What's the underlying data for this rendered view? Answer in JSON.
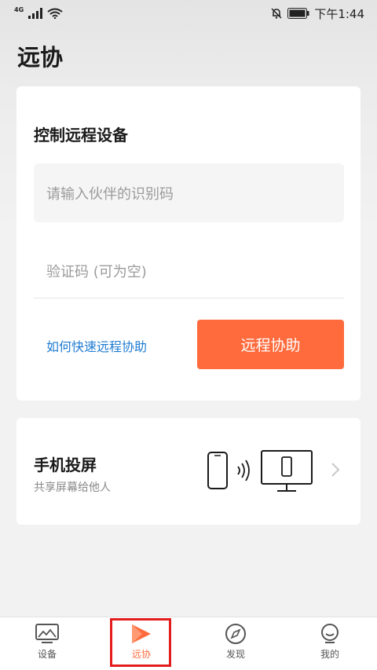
{
  "status_bar": {
    "network": "4G",
    "time": "下午1:44"
  },
  "page": {
    "title": "远协"
  },
  "remote_card": {
    "title": "控制远程设备",
    "partner_placeholder": "请输入伙伴的识别码",
    "code_placeholder": "验证码 (可为空)",
    "help_link": "如何快速远程协助",
    "assist_button": "远程协助"
  },
  "cast_card": {
    "title": "手机投屏",
    "subtitle": "共享屏幕给他人"
  },
  "tabbar": {
    "items": [
      {
        "label": "设备",
        "icon": "monitor-icon"
      },
      {
        "label": "远协",
        "icon": "remote-assist-icon"
      },
      {
        "label": "发现",
        "icon": "compass-icon"
      },
      {
        "label": "我的",
        "icon": "profile-icon"
      }
    ],
    "active_index": 1
  },
  "colors": {
    "accent": "#ff6b3d",
    "link": "#1f7bd2",
    "highlight_box": "#e31d1d"
  }
}
